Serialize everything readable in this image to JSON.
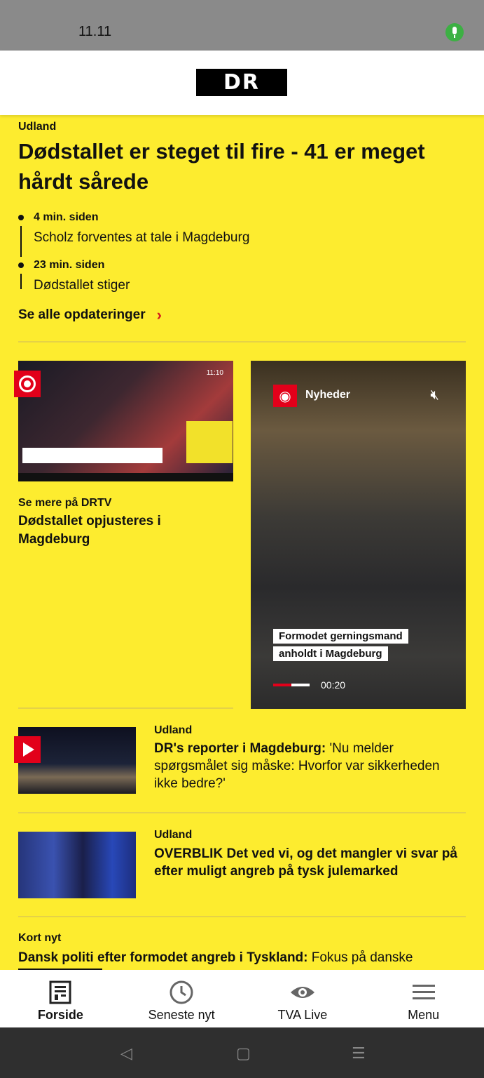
{
  "status_bar": {
    "time": "11.11"
  },
  "header": {
    "logo": "DR"
  },
  "hero": {
    "kicker": "Udland",
    "title": "Dødstallet er steget til fire - 41 er meget hårdt sårede",
    "updates": [
      {
        "time": "4 min. siden",
        "text": "Scholz forventes at tale i Magdeburg"
      },
      {
        "time": "23 min. siden",
        "text": "Dødstallet stiger"
      }
    ],
    "see_all": "Se alle opdateringer"
  },
  "drtv_card": {
    "kicker": "Se mere på DRTV",
    "title": "Dødstallet opjusteres i Magdeburg",
    "thumb_clock": "11:10"
  },
  "video_card": {
    "brand": "Nyheder",
    "caption": "Formodet gerningsmand anholdt i Magdeburg",
    "duration": "00:20",
    "progress": 0.5
  },
  "articles": [
    {
      "kicker": "Udland",
      "lead": "DR's reporter i Magdeburg:",
      "title": " 'Nu melder spørgsmålet sig måske: Hvorfor var sikkerheden ikke bedre?'"
    },
    {
      "kicker": "Udland",
      "lead": "OVERBLIK Det ved vi, og det mangler vi svar på efter muligt angreb på tysk julemarked",
      "title": ""
    }
  ],
  "short_news": {
    "kicker": "Kort nyt",
    "lead": "Dansk politi efter formodet angreb i Tyskland:",
    "title": " Fokus på danske"
  },
  "tabs": [
    {
      "label": "Forside",
      "icon": "front-page-icon",
      "active": true
    },
    {
      "label": "Seneste nyt",
      "icon": "clock-icon",
      "active": false
    },
    {
      "label": "TVA Live",
      "icon": "eye-icon",
      "active": false
    },
    {
      "label": "Menu",
      "icon": "hamburger-icon",
      "active": false
    }
  ],
  "colors": {
    "background": "#fdec2f",
    "accent_red": "#e2001a",
    "logo_bg": "#000000"
  }
}
